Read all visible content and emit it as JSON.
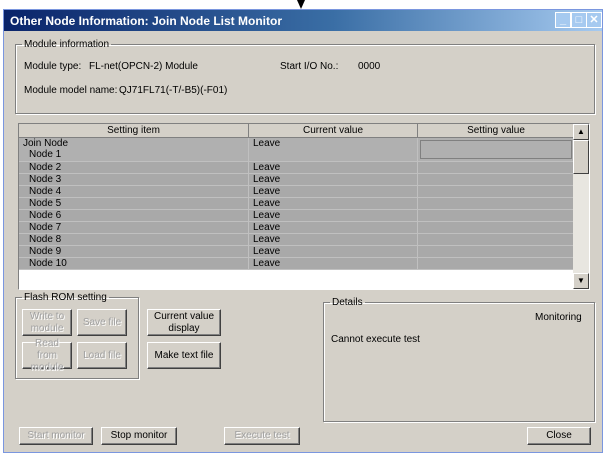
{
  "window": {
    "title": "Other Node Information: Join Node List Monitor"
  },
  "module_info": {
    "legend": "Module information",
    "type_label": "Module type:",
    "type_value": "FL-net(OPCN-2) Module",
    "start_io_label": "Start I/O No.:",
    "start_io_value": "0000",
    "model_label": "Module model name:",
    "model_value": "QJ71FL71(-T/-B5)(-F01)"
  },
  "table": {
    "headers": [
      "Setting item",
      "Current value",
      "Setting value"
    ],
    "first_row": {
      "group": "Join Node",
      "item": "Node 1",
      "current": "Leave",
      "setting": ""
    },
    "rows": [
      {
        "item": "Node 2",
        "current": "Leave"
      },
      {
        "item": "Node 3",
        "current": "Leave"
      },
      {
        "item": "Node 4",
        "current": "Leave"
      },
      {
        "item": "Node 5",
        "current": "Leave"
      },
      {
        "item": "Node 6",
        "current": "Leave"
      },
      {
        "item": "Node 7",
        "current": "Leave"
      },
      {
        "item": "Node 8",
        "current": "Leave"
      },
      {
        "item": "Node 9",
        "current": "Leave"
      },
      {
        "item": "Node 10",
        "current": "Leave"
      }
    ]
  },
  "flash_rom": {
    "legend": "Flash ROM setting",
    "write_to_module": "Write to module",
    "save_file": "Save file",
    "read_from_module": "Read from module",
    "load_file": "Load file"
  },
  "actions": {
    "current_value_display": "Current value display",
    "make_text_file": "Make text file"
  },
  "details": {
    "legend": "Details",
    "status": "Monitoring",
    "message": "Cannot execute test"
  },
  "footer": {
    "start_monitor": "Start monitor",
    "stop_monitor": "Stop monitor",
    "execute_test": "Execute test",
    "close": "Close"
  },
  "colors": {
    "title_start": "#0a246a",
    "title_end": "#a6caf0",
    "row_bg": "#a9a9a9",
    "face": "#d4d0c8"
  }
}
